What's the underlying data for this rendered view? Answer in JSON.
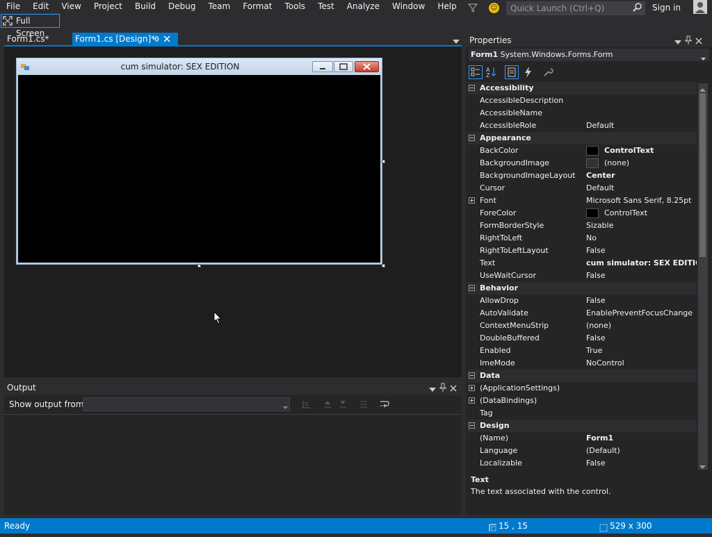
{
  "menu": {
    "items": [
      "File",
      "Edit",
      "View",
      "Project",
      "Build",
      "Debug",
      "Team",
      "Format",
      "Tools",
      "Test",
      "Analyze",
      "Window",
      "Help"
    ],
    "quick_launch_placeholder": "Quick Launch (Ctrl+Q)",
    "sign_in": "Sign in"
  },
  "fullscreen_label": "Full Screen",
  "doc_tabs": [
    {
      "label": "Form1.cs*",
      "active": false
    },
    {
      "label": "Form1.cs [Design]*",
      "active": true
    }
  ],
  "designer": {
    "form_title": "cum simulator: SEX EDITION"
  },
  "output": {
    "title": "Output",
    "show_output_from": "Show output from:",
    "source_value": ""
  },
  "properties": {
    "title": "Properties",
    "object_name": "Form1",
    "object_type": "System.Windows.Forms.Form",
    "rows": [
      {
        "kind": "category",
        "name": "Accessibility"
      },
      {
        "kind": "prop",
        "name": "AccessibleDescription",
        "value": ""
      },
      {
        "kind": "prop",
        "name": "AccessibleName",
        "value": ""
      },
      {
        "kind": "prop",
        "name": "AccessibleRole",
        "value": "Default"
      },
      {
        "kind": "category",
        "name": "Appearance"
      },
      {
        "kind": "prop",
        "name": "BackColor",
        "value": "ControlText",
        "swatch": "#000000",
        "bold": true
      },
      {
        "kind": "prop",
        "name": "BackgroundImage",
        "value": "(none)",
        "swatch": "#333333"
      },
      {
        "kind": "prop",
        "name": "BackgroundImageLayout",
        "value": "Center",
        "bold": true
      },
      {
        "kind": "prop",
        "name": "Cursor",
        "value": "Default"
      },
      {
        "kind": "prop",
        "name": "Font",
        "value": "Microsoft Sans Serif, 8.25pt",
        "expandable": true
      },
      {
        "kind": "prop",
        "name": "ForeColor",
        "value": "ControlText",
        "swatch": "#000000"
      },
      {
        "kind": "prop",
        "name": "FormBorderStyle",
        "value": "Sizable"
      },
      {
        "kind": "prop",
        "name": "RightToLeft",
        "value": "No"
      },
      {
        "kind": "prop",
        "name": "RightToLeftLayout",
        "value": "False"
      },
      {
        "kind": "prop",
        "name": "Text",
        "value": "cum simulator: SEX EDITION",
        "bold": true
      },
      {
        "kind": "prop",
        "name": "UseWaitCursor",
        "value": "False"
      },
      {
        "kind": "category",
        "name": "Behavior"
      },
      {
        "kind": "prop",
        "name": "AllowDrop",
        "value": "False"
      },
      {
        "kind": "prop",
        "name": "AutoValidate",
        "value": "EnablePreventFocusChange"
      },
      {
        "kind": "prop",
        "name": "ContextMenuStrip",
        "value": "(none)"
      },
      {
        "kind": "prop",
        "name": "DoubleBuffered",
        "value": "False"
      },
      {
        "kind": "prop",
        "name": "Enabled",
        "value": "True"
      },
      {
        "kind": "prop",
        "name": "ImeMode",
        "value": "NoControl"
      },
      {
        "kind": "category",
        "name": "Data"
      },
      {
        "kind": "prop",
        "name": "(ApplicationSettings)",
        "value": "",
        "expandable": true
      },
      {
        "kind": "prop",
        "name": "(DataBindings)",
        "value": "",
        "expandable": true
      },
      {
        "kind": "prop",
        "name": "Tag",
        "value": ""
      },
      {
        "kind": "category",
        "name": "Design"
      },
      {
        "kind": "prop",
        "name": "(Name)",
        "value": "Form1",
        "bold": true
      },
      {
        "kind": "prop",
        "name": "Language",
        "value": "(Default)"
      },
      {
        "kind": "prop",
        "name": "Localizable",
        "value": "False"
      }
    ],
    "description_title": "Text",
    "description_text": "The text associated with the control."
  },
  "status": {
    "text": "Ready",
    "position": "15 , 15",
    "size": "529 x 300"
  },
  "colors": {
    "accent": "#007acc",
    "background": "#2d2d30",
    "designer_background": "#1e1e1e"
  }
}
